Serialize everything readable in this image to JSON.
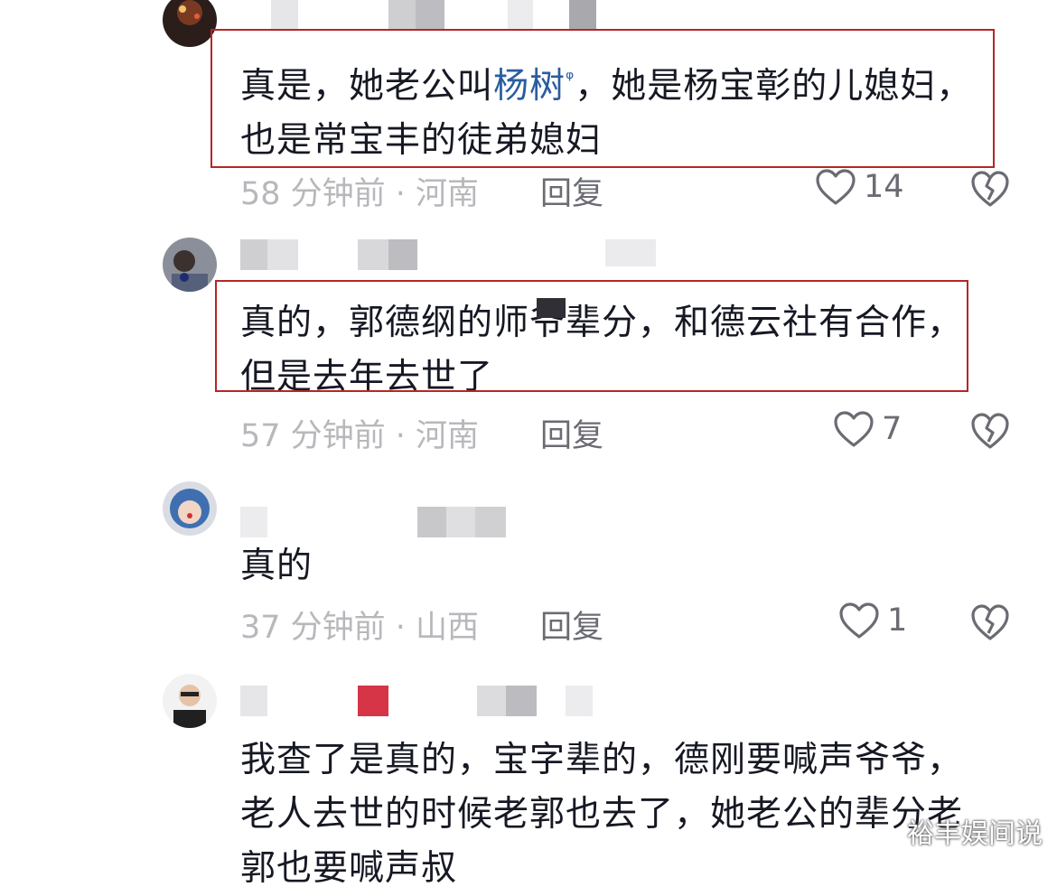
{
  "comments": [
    {
      "text_a": "真是，她老公叫",
      "link": "杨树",
      "text_b": "，她是杨宝彰的儿媳妇，也是常宝丰的徒弟媳妇",
      "time_location": "58 分钟前 · 河南",
      "reply_label": "回复",
      "likes": "14"
    },
    {
      "text": "真的，郭德纲的师爷辈分，和德云社有合作，但是去年去世了",
      "time_location": "57 分钟前 · 河南",
      "reply_label": "回复",
      "likes": "7"
    },
    {
      "text": "真的",
      "time_location": "37 分钟前 · 山西",
      "reply_label": "回复",
      "likes": "1"
    },
    {
      "text": "我查了是真的，宝字辈的，德刚要喊声爷爷，老人去世的时候老郭也去了，她老公的辈分老郭也要喊声叔"
    }
  ],
  "watermark": "裕丰娱间说",
  "colors": {
    "highlight": "#b52626",
    "link": "#2a5d9f",
    "meta": "#b8b8bc",
    "action": "#6b6c73"
  },
  "icons": [
    "heart-outline-icon",
    "broken-heart-icon",
    "search-mark-icon"
  ]
}
